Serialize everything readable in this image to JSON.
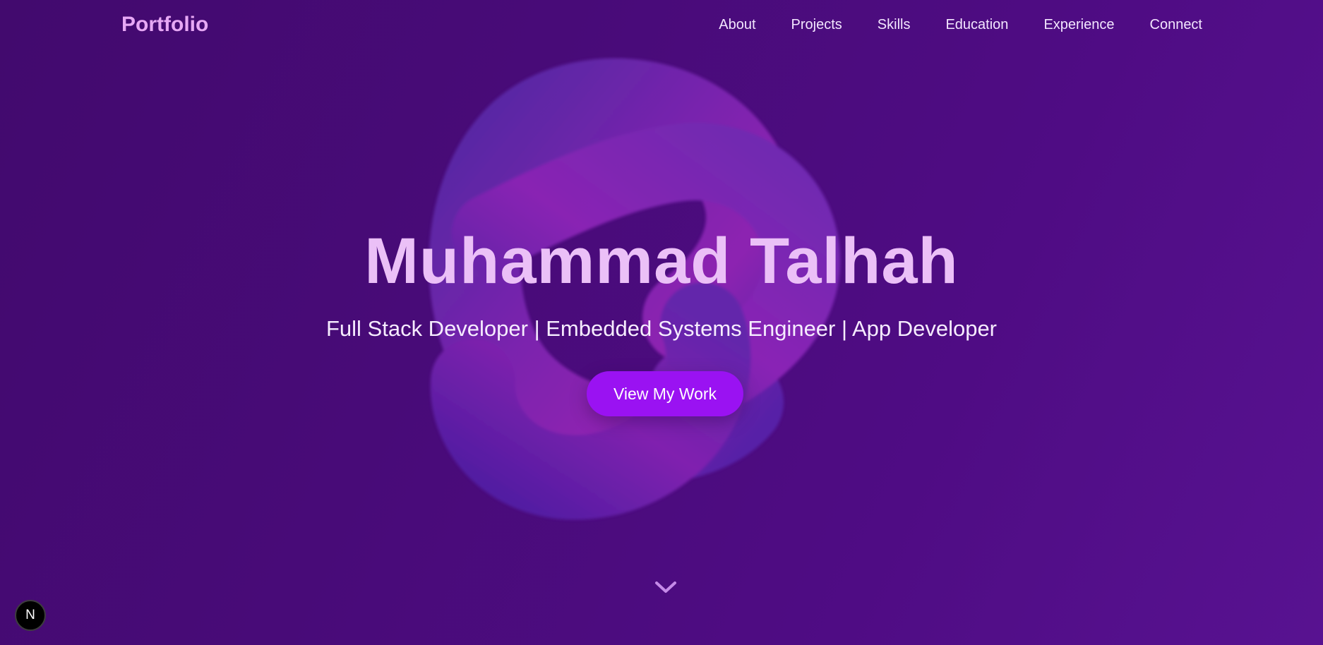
{
  "nav": {
    "brand": "Portfolio",
    "links": [
      "About",
      "Projects",
      "Skills",
      "Education",
      "Experience",
      "Connect"
    ]
  },
  "hero": {
    "title": "Muhammad Talhah",
    "subtitle": "Full Stack Developer | Embedded Systems Engineer | App Developer",
    "cta_label": "View My Work"
  },
  "badge": {
    "letter": "N"
  },
  "icons": {
    "scroll_indicator": "chevron-down-icon",
    "background_shape": "torus-knot"
  },
  "colors": {
    "background_start": "#420a6e",
    "background_end": "#581291",
    "brand": "#e7a8f5",
    "title": "#ebc0f7",
    "accent_button": "#9a12f2",
    "chevron": "#c58be8"
  }
}
